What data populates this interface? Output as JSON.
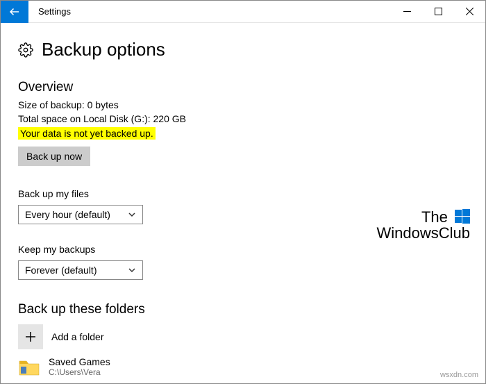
{
  "titlebar": {
    "title": "Settings"
  },
  "page": {
    "title": "Backup options"
  },
  "overview": {
    "header": "Overview",
    "size_line": "Size of backup: 0 bytes",
    "space_line": "Total space on Local Disk (G:): 220 GB",
    "status_line": "Your data is not yet backed up.",
    "backup_button": "Back up now"
  },
  "frequency": {
    "label": "Back up my files",
    "value": "Every hour (default)"
  },
  "retention": {
    "label": "Keep my backups",
    "value": "Forever (default)"
  },
  "folders": {
    "header": "Back up these folders",
    "add_label": "Add a folder",
    "items": [
      {
        "name": "Saved Games",
        "path": "C:\\Users\\Vera"
      }
    ]
  },
  "watermark": {
    "line1": "The",
    "line2": "WindowsClub"
  },
  "footer": {
    "wsxdn": "wsxdn.com"
  }
}
